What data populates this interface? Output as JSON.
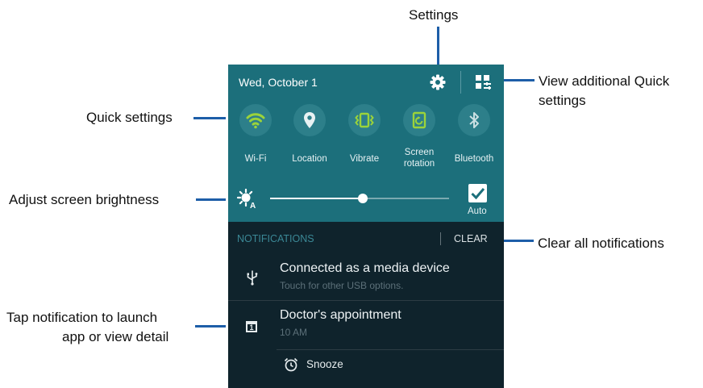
{
  "callouts": {
    "settings": "Settings",
    "view_additional_line1": "View additional Quick",
    "view_additional_line2": "settings",
    "quick_settings": "Quick settings",
    "brightness": "Adjust screen brightness",
    "clear_all": "Clear all notifications",
    "tap_line1": "Tap notification to launch",
    "tap_line2": "app or view detail"
  },
  "status": {
    "date": "Wed, October 1"
  },
  "quick_settings": [
    {
      "label": "Wi-Fi",
      "icon": "wifi-icon",
      "active": true
    },
    {
      "label": "Location",
      "icon": "location-icon",
      "active": false
    },
    {
      "label": "Vibrate",
      "icon": "vibrate-icon",
      "active": true
    },
    {
      "label_line1": "Screen",
      "label_line2": "rotation",
      "icon": "screen-rotation-icon",
      "active": true
    },
    {
      "label": "Bluetooth",
      "icon": "bluetooth-icon",
      "active": false
    }
  ],
  "brightness": {
    "level": 0.52,
    "auto_label": "Auto",
    "auto_checked": true
  },
  "notifications": {
    "header": "NOTIFICATIONS",
    "clear": "CLEAR",
    "items": [
      {
        "title": "Connected as a media device",
        "subtitle": "Touch for other USB options.",
        "icon": "usb-icon"
      },
      {
        "title": "Doctor's appointment",
        "subtitle": "10 AM",
        "icon": "calendar-icon",
        "calendar_day": "1"
      }
    ],
    "snooze": "Snooze"
  },
  "colors": {
    "panel_teal": "#1c6f7b",
    "panel_dark": "#0f232c",
    "active_green": "#9bd33a",
    "callout_line": "#1d5ea8"
  }
}
